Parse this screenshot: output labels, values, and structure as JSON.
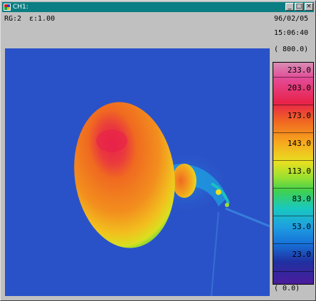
{
  "window": {
    "title": "CH1:",
    "minimize_glyph": "_",
    "maximize_glyph": "□",
    "close_glyph": "×"
  },
  "info": {
    "range": "RG:2",
    "emissivity": "ε:1.00",
    "date": "96/02/05",
    "time": "15:06:40"
  },
  "scale": {
    "max_label": "( 800.0)",
    "min_label": "( 0.0)",
    "ticks": [
      "233.0",
      "203.0",
      "173.0",
      "143.0",
      "113.0",
      "83.0",
      "53.0",
      "23.0"
    ]
  },
  "colors": {
    "titlebar": "#0a7e82",
    "background": "#2a52c8",
    "hot": "#e8224a",
    "warm": "#f06a20",
    "mid": "#e8e020",
    "cool": "#19c8c0"
  }
}
